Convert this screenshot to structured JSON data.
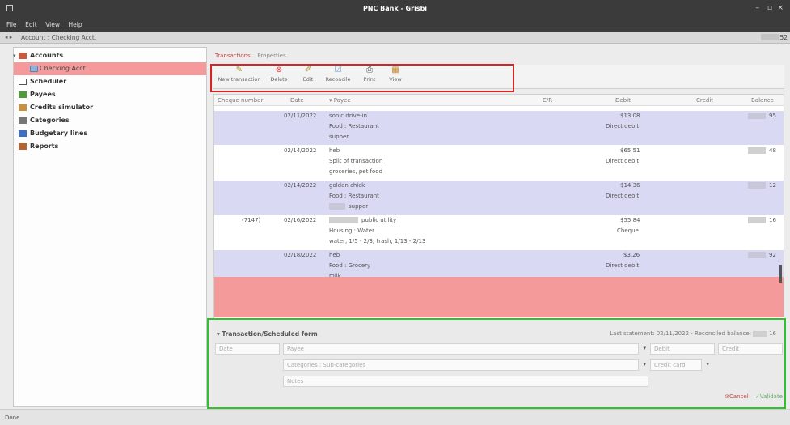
{
  "window": {
    "title": "PNC Bank - Grisbi",
    "minimize": "–",
    "maximize": "▫",
    "close": "×"
  },
  "menu": [
    "File",
    "Edit",
    "View",
    "Help"
  ],
  "breadcrumb": {
    "arrows": "◂ ▸",
    "path": "Account : Checking Acct.",
    "count": "52"
  },
  "sidebar": {
    "items": [
      {
        "label": "Accounts",
        "icon": "accounts-icon"
      },
      {
        "label": "Checking Acct.",
        "icon": "bank-icon"
      },
      {
        "label": "Scheduler",
        "icon": "calendar-icon"
      },
      {
        "label": "Payees",
        "icon": "payees-icon"
      },
      {
        "label": "Credits simulator",
        "icon": "credits-icon"
      },
      {
        "label": "Categories",
        "icon": "categories-icon"
      },
      {
        "label": "Budgetary lines",
        "icon": "budget-icon"
      },
      {
        "label": "Reports",
        "icon": "reports-icon"
      }
    ]
  },
  "tabs": {
    "transactions": "Transactions",
    "properties": "Properties"
  },
  "toolbar": {
    "new": "New transaction",
    "delete": "Delete",
    "edit": "Edit",
    "reconcile": "Reconcile",
    "print": "Print",
    "view": "View"
  },
  "table": {
    "headers": {
      "cheque": "Cheque number",
      "date": "Date",
      "payee": "Payee",
      "cr": "C/R",
      "debit": "Debit",
      "credit": "Credit",
      "balance": "Balance"
    },
    "rows": [
      {
        "cheque": "",
        "date": "02/11/2022",
        "payee": "sonic drive-in",
        "category": "Food : Restaurant",
        "note": "supper",
        "debit": "$13.08",
        "method": "Direct debit",
        "balance": "95"
      },
      {
        "cheque": "",
        "date": "02/14/2022",
        "payee": "heb",
        "category": "Split of transaction",
        "note": "groceries, pet food",
        "debit": "$65.51",
        "method": "Direct debit",
        "balance": "48"
      },
      {
        "cheque": "",
        "date": "02/14/2022",
        "payee": "golden chick",
        "category": "Food : Restaurant",
        "note": "supper",
        "debit": "$14.36",
        "method": "Direct debit",
        "balance": "12"
      },
      {
        "cheque": "(7147)",
        "date": "02/16/2022",
        "payee": "public utility",
        "category": "Housing : Water",
        "note": "water, 1/5 - 2/3; trash, 1/13 - 2/13",
        "debit": "$55.84",
        "method": "Cheque",
        "balance": "16"
      },
      {
        "cheque": "",
        "date": "02/18/2022",
        "payee": "heb",
        "category": "Food : Grocery",
        "note": "milk",
        "debit": "$3.26",
        "method": "Direct debit",
        "balance": "92"
      }
    ]
  },
  "form": {
    "title": "Transaction/Scheduled form",
    "statement_prefix": "Last statement: 02/11/2022 - Reconciled balance:",
    "statement_value": "16",
    "date_placeholder": "Date",
    "payee_placeholder": "Payee",
    "debit_placeholder": "Debit",
    "credit_placeholder": "Credit",
    "category_placeholder": "Categories : Sub-categories",
    "method_placeholder": "Credit card",
    "notes_placeholder": "Notes",
    "cancel": "Cancel",
    "validate": "Validate"
  },
  "status": "Done",
  "colors": {
    "highlight_red": "#d62424",
    "highlight_green": "#2fbf2f",
    "row_alt": "#d9d9f3",
    "selected": "#f49a9a"
  }
}
